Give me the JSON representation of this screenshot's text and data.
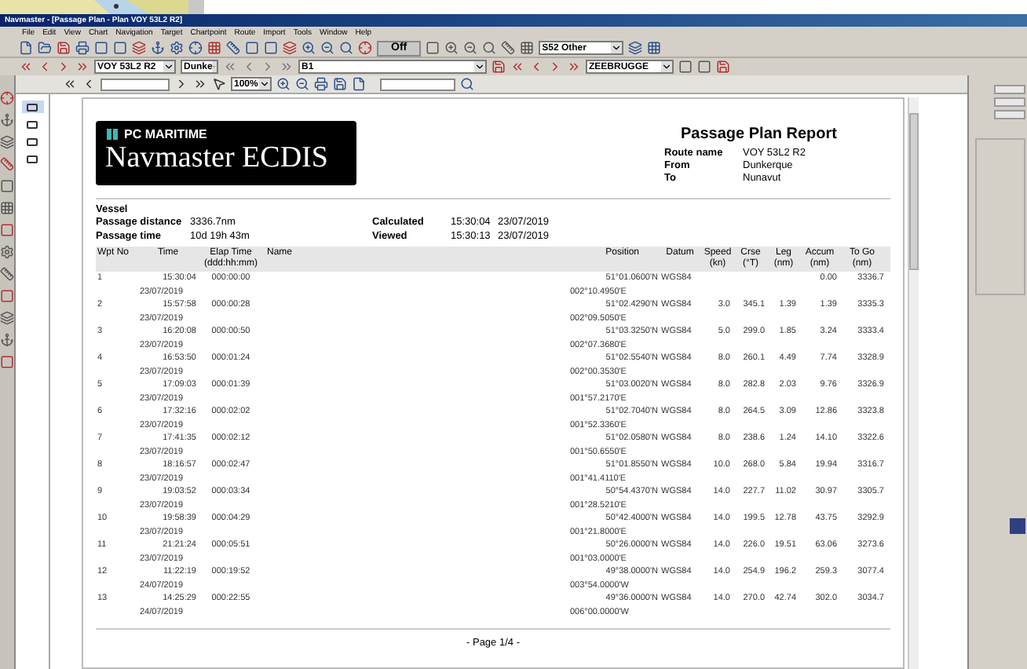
{
  "window": {
    "title": "Navmaster - [Passage Plan - Plan VOY 53L2 R2]"
  },
  "menu": [
    "File",
    "Edit",
    "View",
    "Chart",
    "Navigation",
    "Target",
    "Chartpoint",
    "Route",
    "Import",
    "Tools",
    "Window",
    "Help"
  ],
  "toolbar": {
    "display_button": "Off",
    "chart_filter": "S52 Other",
    "route": "VOY 53L2 R2",
    "start": "Dunke",
    "leg": "B1",
    "destination": "ZEEBRUGGE"
  },
  "preview_toolbar": {
    "zoom": "100%"
  },
  "thumbnails": [
    {
      "selected": true
    },
    {
      "selected": false
    },
    {
      "selected": false
    },
    {
      "selected": false
    }
  ],
  "report": {
    "logo_top": "PC MARITIME",
    "logo_main": "Navmaster ECDIS",
    "title": "Passage Plan Report",
    "route_fields": [
      {
        "label": "Route name",
        "value": "VOY 53L2 R2"
      },
      {
        "label": "From",
        "value": "Dunkerque"
      },
      {
        "label": "To",
        "value": "Nunavut"
      }
    ],
    "vessel_label": "Vessel",
    "summary": [
      {
        "label": "Passage distance",
        "value": "3336.7nm"
      },
      {
        "label": "Passage time",
        "value": "10d 19h 43m"
      }
    ],
    "timestamps": [
      {
        "label": "Calculated",
        "time": "15:30:04",
        "date": "23/07/2019"
      },
      {
        "label": "Viewed",
        "time": "15:30:13",
        "date": "23/07/2019"
      }
    ],
    "columns": [
      {
        "label": "Wpt No"
      },
      {
        "label": "Time"
      },
      {
        "label": "Elap Time",
        "unit": "(ddd:hh:mm)"
      },
      {
        "label": "Name"
      },
      {
        "label": "Position"
      },
      {
        "label": "Datum"
      },
      {
        "label": "Speed",
        "unit": "(kn)"
      },
      {
        "label": "Crse",
        "unit": "(°T)"
      },
      {
        "label": "Leg",
        "unit": "(nm)"
      },
      {
        "label": "Accum",
        "unit": "(nm)"
      },
      {
        "label": "To Go",
        "unit": "(nm)"
      }
    ],
    "rows": [
      {
        "wpt": "1",
        "time": "15:30:04",
        "date": "23/07/2019",
        "elapsed": "000:00:00",
        "lat": "51°01.0600'N",
        "lon": "002°10.4950'E",
        "datum": "WGS84",
        "speed": "",
        "course": "",
        "leg": "",
        "accum": "0.00",
        "to_go": "3336.7"
      },
      {
        "wpt": "2",
        "time": "15:57:58",
        "date": "23/07/2019",
        "elapsed": "000:00:28",
        "lat": "51°02.4290'N",
        "lon": "002°09.5050'E",
        "datum": "WGS84",
        "speed": "3.0",
        "course": "345.1",
        "leg": "1.39",
        "accum": "1.39",
        "to_go": "3335.3"
      },
      {
        "wpt": "3",
        "time": "16:20:08",
        "date": "23/07/2019",
        "elapsed": "000:00:50",
        "lat": "51°03.3250'N",
        "lon": "002°07.3680'E",
        "datum": "WGS84",
        "speed": "5.0",
        "course": "299.0",
        "leg": "1.85",
        "accum": "3.24",
        "to_go": "3333.4"
      },
      {
        "wpt": "4",
        "time": "16:53:50",
        "date": "23/07/2019",
        "elapsed": "000:01:24",
        "lat": "51°02.5540'N",
        "lon": "002°00.3530'E",
        "datum": "WGS84",
        "speed": "8.0",
        "course": "260.1",
        "leg": "4.49",
        "accum": "7.74",
        "to_go": "3328.9"
      },
      {
        "wpt": "5",
        "time": "17:09:03",
        "date": "23/07/2019",
        "elapsed": "000:01:39",
        "lat": "51°03.0020'N",
        "lon": "001°57.2170'E",
        "datum": "WGS84",
        "speed": "8.0",
        "course": "282.8",
        "leg": "2.03",
        "accum": "9.76",
        "to_go": "3326.9"
      },
      {
        "wpt": "6",
        "time": "17:32:16",
        "date": "23/07/2019",
        "elapsed": "000:02:02",
        "lat": "51°02.7040'N",
        "lon": "001°52.3360'E",
        "datum": "WGS84",
        "speed": "8.0",
        "course": "264.5",
        "leg": "3.09",
        "accum": "12.86",
        "to_go": "3323.8"
      },
      {
        "wpt": "7",
        "time": "17:41:35",
        "date": "23/07/2019",
        "elapsed": "000:02:12",
        "lat": "51°02.0580'N",
        "lon": "001°50.6550'E",
        "datum": "WGS84",
        "speed": "8.0",
        "course": "238.6",
        "leg": "1.24",
        "accum": "14.10",
        "to_go": "3322.6"
      },
      {
        "wpt": "8",
        "time": "18:16:57",
        "date": "23/07/2019",
        "elapsed": "000:02:47",
        "lat": "51°01.8550'N",
        "lon": "001°41.4110'E",
        "datum": "WGS84",
        "speed": "10.0",
        "course": "268.0",
        "leg": "5.84",
        "accum": "19.94",
        "to_go": "3316.7"
      },
      {
        "wpt": "9",
        "time": "19:03:52",
        "date": "23/07/2019",
        "elapsed": "000:03:34",
        "lat": "50°54.4370'N",
        "lon": "001°28.5210'E",
        "datum": "WGS84",
        "speed": "14.0",
        "course": "227.7",
        "leg": "11.02",
        "accum": "30.97",
        "to_go": "3305.7"
      },
      {
        "wpt": "10",
        "time": "19:58:39",
        "date": "23/07/2019",
        "elapsed": "000:04:29",
        "lat": "50°42.4000'N",
        "lon": "001°21.8000'E",
        "datum": "WGS84",
        "speed": "14.0",
        "course": "199.5",
        "leg": "12.78",
        "accum": "43.75",
        "to_go": "3292.9"
      },
      {
        "wpt": "11",
        "time": "21:21:24",
        "date": "23/07/2019",
        "elapsed": "000:05:51",
        "lat": "50°26.0000'N",
        "lon": "001°03.0000'E",
        "datum": "WGS84",
        "speed": "14.0",
        "course": "226.0",
        "leg": "19.51",
        "accum": "63.06",
        "to_go": "3273.6"
      },
      {
        "wpt": "12",
        "time": "11:22:19",
        "date": "24/07/2019",
        "elapsed": "000:19:52",
        "lat": "49°38.0000'N",
        "lon": "003°54.0000'W",
        "datum": "WGS84",
        "speed": "14.0",
        "course": "254.9",
        "leg": "196.2",
        "accum": "259.3",
        "to_go": "3077.4"
      },
      {
        "wpt": "13",
        "time": "14:25:29",
        "date": "24/07/2019",
        "elapsed": "000:22:55",
        "lat": "49°36.0000'N",
        "lon": "006°00.0000'W",
        "datum": "WGS84",
        "speed": "14.0",
        "course": "270.0",
        "leg": "42.74",
        "accum": "302.0",
        "to_go": "3034.7"
      }
    ],
    "footer": "- Page 1/4 -"
  }
}
